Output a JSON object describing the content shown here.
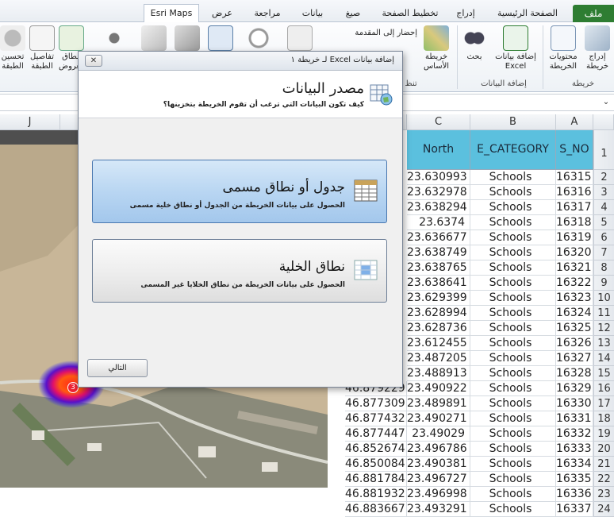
{
  "ribbon_tabs": [
    "ملف",
    "الصفحة الرئيسية",
    "إدراج",
    "تخطيط الصفحة",
    "صيغ",
    "بيانات",
    "مراجعة",
    "عرض",
    "Esri Maps"
  ],
  "ribbon": {
    "groups": {
      "map": "خريطة",
      "add_data": "إضافة البيانات",
      "arrange_group": "تنظ"
    },
    "buttons": {
      "insert_map": "إدراج خريطة",
      "map_contents": "محتويات الخريطة",
      "add_excel": "إضافة بيانات Excel",
      "search": "بحث",
      "basemap": "خريطة الأساس",
      "bring_front": "إحضار إلى المقدمة",
      "layer_details": "تفاصيل الطبقة",
      "layer_style": "تحسين الطبقة",
      "show_label": "نطاق العروض"
    }
  },
  "sheet": {
    "col_headers": [
      "A",
      "B",
      "C",
      "J"
    ],
    "row_numbers": [
      1,
      2,
      3,
      4,
      5,
      6,
      7,
      8,
      9,
      10,
      11,
      12,
      13,
      14,
      15,
      16,
      17,
      18,
      19,
      20,
      21,
      22,
      23,
      24
    ],
    "header_row": {
      "a": "S_NO",
      "b": "E_CATEGORY",
      "c": "North"
    },
    "rows": [
      {
        "s_no": "16315",
        "cat": "Schools",
        "north": "23.630993"
      },
      {
        "s_no": "16316",
        "cat": "Schools",
        "north": "23.632978"
      },
      {
        "s_no": "16317",
        "cat": "Schools",
        "north": "23.638294"
      },
      {
        "s_no": "16318",
        "cat": "Schools",
        "north": "23.6374"
      },
      {
        "s_no": "16319",
        "cat": "Schools",
        "north": "23.636677"
      },
      {
        "s_no": "16320",
        "cat": "Schools",
        "north": "23.638749"
      },
      {
        "s_no": "16321",
        "cat": "Schools",
        "north": "23.638765"
      },
      {
        "s_no": "16322",
        "cat": "Schools",
        "north": "23.638641"
      },
      {
        "s_no": "16323",
        "cat": "Schools",
        "north": "23.629399"
      },
      {
        "s_no": "16324",
        "cat": "Schools",
        "north": "23.628994"
      },
      {
        "s_no": "16325",
        "cat": "Schools",
        "north": "23.628736"
      },
      {
        "s_no": "16326",
        "cat": "Schools",
        "north": "23.612455"
      },
      {
        "s_no": "16327",
        "cat": "Schools",
        "north": "23.487205"
      },
      {
        "s_no": "16328",
        "cat": "Schools",
        "north": "23.488913"
      },
      {
        "s_no": "16329",
        "cat": "Schools",
        "north": "23.490922",
        "east": "46.879229"
      },
      {
        "s_no": "16330",
        "cat": "Schools",
        "north": "23.489891",
        "east": "46.877309"
      },
      {
        "s_no": "16331",
        "cat": "Schools",
        "north": "23.490271",
        "east": "46.877432"
      },
      {
        "s_no": "16332",
        "cat": "Schools",
        "north": "23.49029",
        "east": "46.877447"
      },
      {
        "s_no": "16333",
        "cat": "Schools",
        "north": "23.496786",
        "east": "46.852674"
      },
      {
        "s_no": "16334",
        "cat": "Schools",
        "north": "23.490381",
        "east": "46.850084"
      },
      {
        "s_no": "16335",
        "cat": "Schools",
        "north": "23.496727",
        "east": "46.881784"
      },
      {
        "s_no": "16336",
        "cat": "Schools",
        "north": "23.496998",
        "east": "46.881932"
      },
      {
        "s_no": "16337",
        "cat": "Schools",
        "north": "23.493291",
        "east": "46.883667"
      }
    ]
  },
  "map": {
    "cluster_count": "3"
  },
  "dialog": {
    "title": "إضافة بيانات Excel لـ خريطة ١",
    "close_label": "✕",
    "heading": "مصدر البيانات",
    "subheading": "كيف تكون البيانات التي ترغب أن تقوم الخريطة بتخزينها؟",
    "options": [
      {
        "title": "جدول أو نطاق مسمى",
        "desc": "الحصول على بيانات الخريطة من الجدول أو نطاق خلية مسمى"
      },
      {
        "title": "نطاق الخلية",
        "desc": "الحصول على بيانات الخريطة من نطاق الخلايا غير المسمى"
      }
    ],
    "next_label": "التالي"
  },
  "colors": {
    "file_tab": "#2e7d32",
    "header_fill": "#5bc0de",
    "selected_option": "#b9d6f2"
  }
}
